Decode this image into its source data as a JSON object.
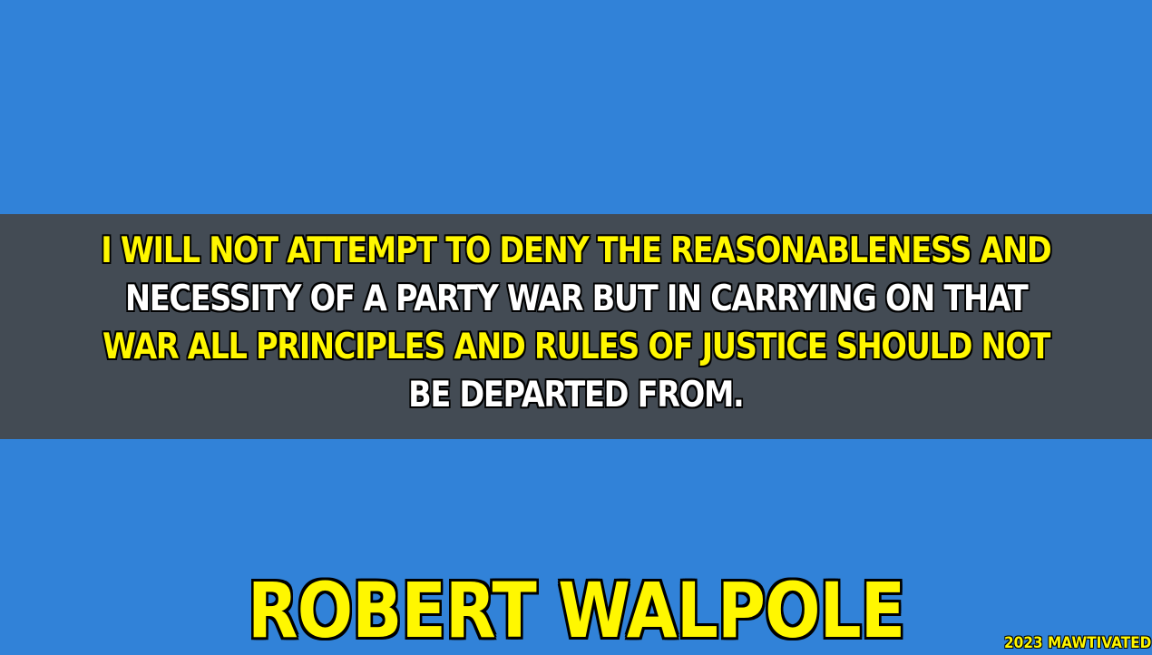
{
  "quote": {
    "lines": [
      "I WILL NOT ATTEMPT TO DENY THE REASONABLENESS AND",
      "NECESSITY OF A PARTY WAR BUT IN CARRYING ON THAT",
      "WAR ALL PRINCIPLES AND RULES OF JUSTICE SHOULD NOT",
      "BE DEPARTED FROM."
    ]
  },
  "author": "ROBERT WALPOLE",
  "credit": "2023 MAWTIVATED",
  "colors": {
    "background": "#3182d8",
    "band": "#434b54",
    "accent_yellow": "#fff700",
    "text_white": "#ffffff"
  }
}
